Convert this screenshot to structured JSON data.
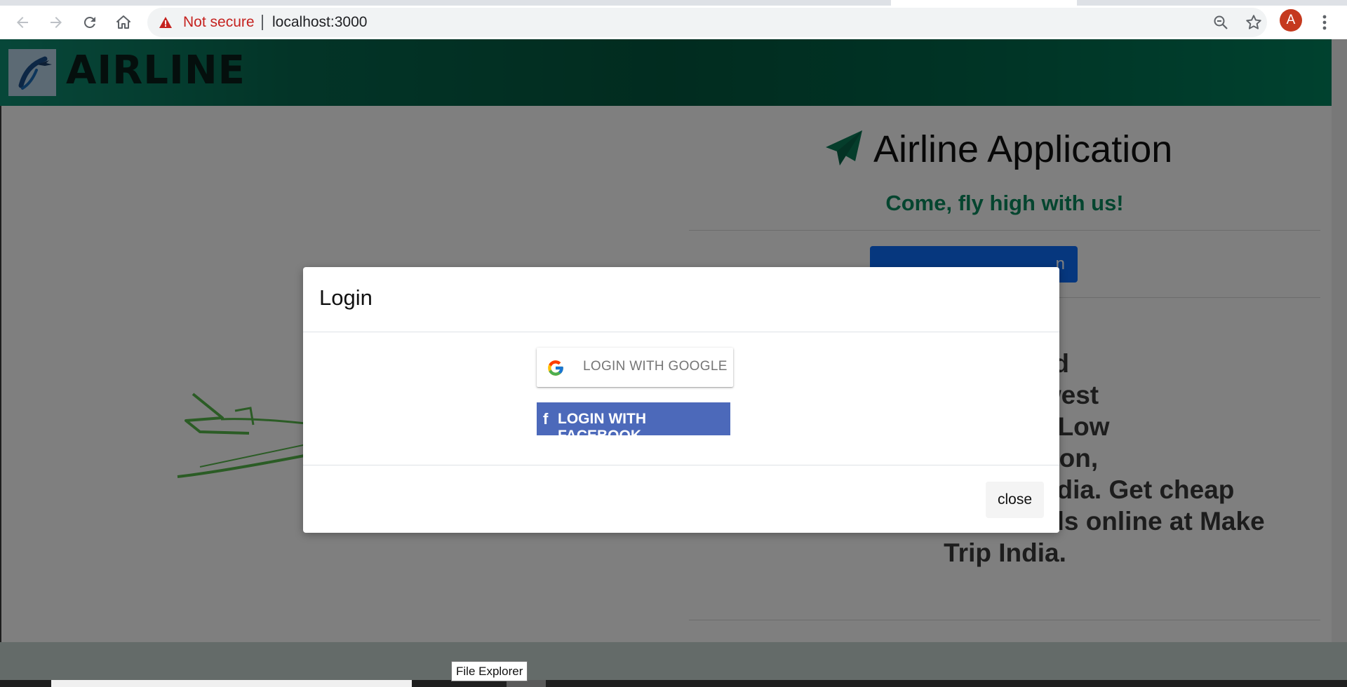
{
  "browser": {
    "security_label": "Not secure",
    "url": "localhost:3000",
    "profile_initial": "A",
    "icons": [
      "back-icon",
      "forward-icon",
      "reload-icon",
      "home-icon",
      "warning-icon",
      "zoom-out-icon",
      "bookmark-star-icon",
      "more-vert-icon"
    ]
  },
  "header": {
    "brand": "AIRLINE",
    "logo_icon": "airplane-logo-icon"
  },
  "hero": {
    "title": "Airline Application",
    "title_icon": "paper-plane-icon",
    "tagline": "Come, fly high with us!",
    "login_button_fragment": "n",
    "description": "nestic and\nIndia at Lowest\nest deals on Low\nng reservation,\nAirlines operating in India. Get cheap\nfares Airlines Tickets deals online at Make\nTrip India."
  },
  "modal": {
    "title": "Login",
    "google_label": "LOGIN WITH GOOGLE",
    "facebook_label": "LOGIN WITH FACEBOOK",
    "close_label": "close"
  },
  "taskbar": {
    "tooltip": "File Explorer"
  },
  "colors": {
    "header_green": "#03583f",
    "accent_green": "#0a8a5e",
    "facebook_blue": "#4c69ba",
    "primary_blue": "#0d6efd",
    "insecure_red": "#c5221f"
  }
}
